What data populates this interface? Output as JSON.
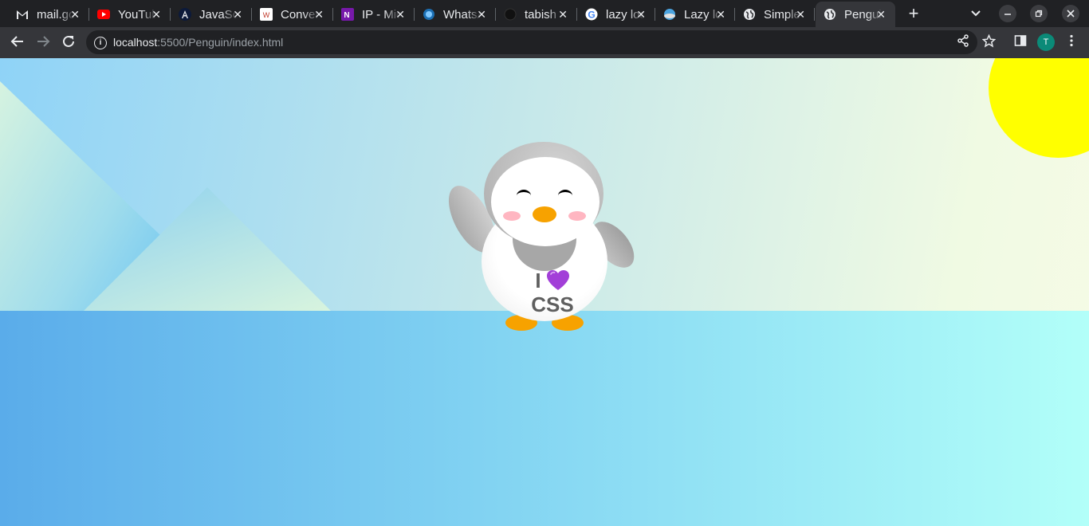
{
  "browser": {
    "tabs": [
      {
        "title": "mail.google.com",
        "icon": "gmail-icon"
      },
      {
        "title": "YouTube",
        "icon": "youtube-icon"
      },
      {
        "title": "JavaScript",
        "icon": "angular-icon"
      },
      {
        "title": "Converter",
        "icon": "converter-icon"
      },
      {
        "title": "IP - Microsoft OneNote",
        "icon": "onenote-icon"
      },
      {
        "title": "WhatsApp",
        "icon": "whatsapp-icon"
      },
      {
        "title": "tabish",
        "icon": "github-icon"
      },
      {
        "title": "lazy loading",
        "icon": "google-icon"
      },
      {
        "title": "Lazy loading",
        "icon": "web-icon"
      },
      {
        "title": "Simple",
        "icon": "globe-icon"
      },
      {
        "title": "Penguin",
        "icon": "globe-icon",
        "active": true
      }
    ],
    "new_tab_label": "+",
    "close_glyph": "✕",
    "address": {
      "host": "localhost",
      "path": ":5500/Penguin/index.html"
    },
    "profile_initial": "T"
  },
  "page": {
    "tshirt_line1": "I",
    "tshirt_line2": "CSS",
    "heart_emoji": "purple-heart",
    "colors": {
      "sun": "#ffff00",
      "beak": "#f7a200",
      "feet": "#f7a200",
      "cheeks": "#ffb6c1",
      "heart": "#a23fd8"
    }
  }
}
